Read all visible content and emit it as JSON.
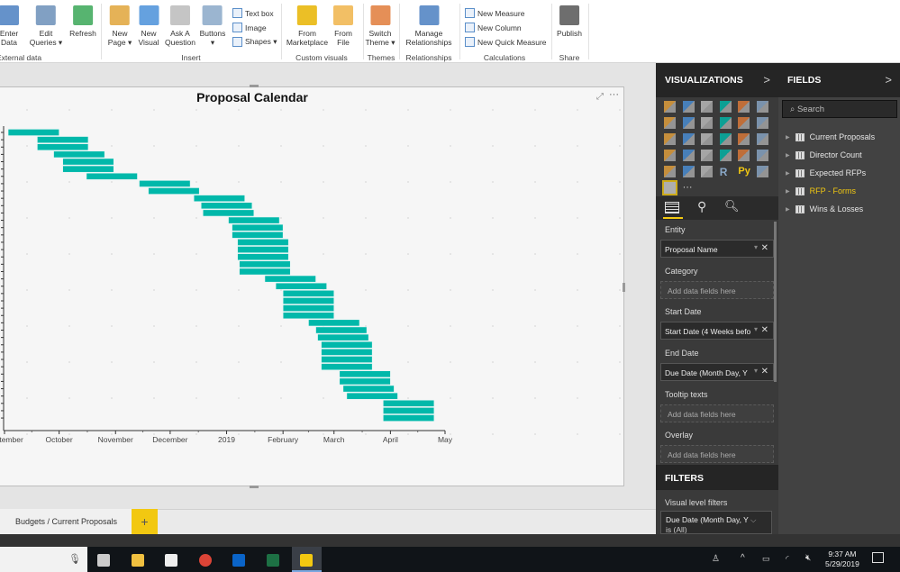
{
  "ribbon": {
    "buttons": [
      {
        "id": "enter-data",
        "label": "Enter\nData",
        "color": "#4a7fc1"
      },
      {
        "id": "edit-queries",
        "label": "Edit\nQueries ▾",
        "color": "#6b8fb8"
      },
      {
        "id": "refresh",
        "label": "Refresh",
        "color": "#3aa757"
      },
      {
        "id": "new-page",
        "label": "New\nPage ▾",
        "color": "#e0a43a"
      },
      {
        "id": "new-visual",
        "label": "New\nVisual",
        "color": "#4a90d9"
      },
      {
        "id": "ask-question",
        "label": "Ask A\nQuestion",
        "color": "#bbbbbb"
      },
      {
        "id": "buttons",
        "label": "Buttons\n▾",
        "color": "#8aa8c8"
      },
      {
        "id": "from-marketplace",
        "label": "From\nMarketplace",
        "color": "#e8b400"
      },
      {
        "id": "from-file",
        "label": "From\nFile",
        "color": "#f0b44a"
      },
      {
        "id": "switch-theme",
        "label": "Switch\nTheme ▾",
        "color": "#e07b39"
      },
      {
        "id": "manage-relationships",
        "label": "Manage\nRelationships",
        "color": "#4a7fc1"
      },
      {
        "id": "publish",
        "label": "Publish",
        "color": "#555555"
      }
    ],
    "small": [
      {
        "id": "text-box",
        "label": "Text box"
      },
      {
        "id": "image",
        "label": "Image"
      },
      {
        "id": "shapes",
        "label": "Shapes ▾"
      },
      {
        "id": "new-measure",
        "label": "New Measure"
      },
      {
        "id": "new-column",
        "label": "New Column"
      },
      {
        "id": "new-quick-measure",
        "label": "New Quick Measure"
      }
    ],
    "groups": [
      "External data",
      "Insert",
      "Custom visuals",
      "Themes",
      "Relationships",
      "Calculations",
      "Share"
    ]
  },
  "visual": {
    "title": "Proposal Calendar",
    "focus_icon": "focus-mode-icon",
    "more_icon": "more-options-icon"
  },
  "chart_data": {
    "type": "gantt",
    "title": "Proposal Calendar",
    "bar_color": "#01b8aa",
    "x_ticks": [
      "September",
      "October",
      "November",
      "December",
      "2019",
      "February",
      "March",
      "April",
      "May"
    ],
    "x_range": [
      "2018-09-01",
      "2019-05-01"
    ],
    "tasks": [
      {
        "start": "2018-09-03",
        "end": "2018-10-01"
      },
      {
        "start": "2018-09-19",
        "end": "2018-10-17"
      },
      {
        "start": "2018-09-19",
        "end": "2018-10-17"
      },
      {
        "start": "2018-09-28",
        "end": "2018-10-26"
      },
      {
        "start": "2018-10-03",
        "end": "2018-10-31"
      },
      {
        "start": "2018-10-03",
        "end": "2018-10-31"
      },
      {
        "start": "2018-10-16",
        "end": "2018-11-13"
      },
      {
        "start": "2018-11-14",
        "end": "2018-12-12"
      },
      {
        "start": "2018-11-19",
        "end": "2018-12-17"
      },
      {
        "start": "2018-12-14",
        "end": "2019-01-11"
      },
      {
        "start": "2018-12-18",
        "end": "2019-01-15"
      },
      {
        "start": "2018-12-19",
        "end": "2019-01-16"
      },
      {
        "start": "2019-01-02",
        "end": "2019-01-30"
      },
      {
        "start": "2019-01-04",
        "end": "2019-02-01"
      },
      {
        "start": "2019-01-04",
        "end": "2019-02-01"
      },
      {
        "start": "2019-01-07",
        "end": "2019-02-04"
      },
      {
        "start": "2019-01-07",
        "end": "2019-02-04"
      },
      {
        "start": "2019-01-07",
        "end": "2019-02-04"
      },
      {
        "start": "2019-01-08",
        "end": "2019-02-05"
      },
      {
        "start": "2019-01-08",
        "end": "2019-02-05"
      },
      {
        "start": "2019-01-22",
        "end": "2019-02-19"
      },
      {
        "start": "2019-01-28",
        "end": "2019-02-25"
      },
      {
        "start": "2019-02-01",
        "end": "2019-03-01"
      },
      {
        "start": "2019-02-01",
        "end": "2019-03-01"
      },
      {
        "start": "2019-02-01",
        "end": "2019-03-01"
      },
      {
        "start": "2019-02-01",
        "end": "2019-03-01"
      },
      {
        "start": "2019-02-15",
        "end": "2019-03-15"
      },
      {
        "start": "2019-02-19",
        "end": "2019-03-19"
      },
      {
        "start": "2019-02-20",
        "end": "2019-03-20"
      },
      {
        "start": "2019-02-22",
        "end": "2019-03-22"
      },
      {
        "start": "2019-02-22",
        "end": "2019-03-22"
      },
      {
        "start": "2019-02-22",
        "end": "2019-03-22"
      },
      {
        "start": "2019-02-22",
        "end": "2019-03-22"
      },
      {
        "start": "2019-03-04",
        "end": "2019-04-01"
      },
      {
        "start": "2019-03-04",
        "end": "2019-04-01"
      },
      {
        "start": "2019-03-06",
        "end": "2019-04-03"
      },
      {
        "start": "2019-03-08",
        "end": "2019-04-05"
      },
      {
        "start": "2019-03-28",
        "end": "2019-04-25"
      },
      {
        "start": "2019-03-28",
        "end": "2019-04-25"
      },
      {
        "start": "2019-03-28",
        "end": "2019-04-25"
      }
    ]
  },
  "pages": {
    "tab": "Budgets / Current Proposals",
    "add": "+"
  },
  "visualizations": {
    "title": "VISUALIZATIONS",
    "chevron": ">",
    "icons": [
      "stacked-bar",
      "stacked-column",
      "clustered-bar",
      "clustered-column",
      "100-stacked-bar",
      "100-stacked-column",
      "line-chart",
      "area-chart",
      "stacked-area",
      "line-stacked-column",
      "line-clustered-column",
      "ribbon-chart",
      "waterfall",
      "scatter",
      "pie",
      "donut",
      "treemap",
      "map",
      "filled-map",
      "funnel",
      "gauge",
      "card",
      "multi-row-card",
      "kpi",
      "slicer",
      "table",
      "matrix",
      "r-visual",
      "python-visual",
      "globe-map",
      "gantt",
      "more"
    ],
    "selected": "gantt",
    "r_label": "R",
    "py_label": "Py",
    "more_label": "···",
    "wells": [
      {
        "label": "Entity",
        "value": "Proposal Name",
        "filled": true
      },
      {
        "label": "Category",
        "value": "Add data fields here",
        "filled": false
      },
      {
        "label": "Start Date",
        "value": "Start Date (4 Weeks befo",
        "filled": true
      },
      {
        "label": "End Date",
        "value": "Due Date (Month Day, Y",
        "filled": true
      },
      {
        "label": "Tooltip texts",
        "value": "Add data fields here",
        "filled": false
      },
      {
        "label": "Overlay",
        "value": "Add data fields here",
        "filled": false
      }
    ],
    "filters": {
      "title": "FILTERS",
      "level": "Visual level filters",
      "filter": "Due Date (Month Day, Y",
      "filter_sub": "is (All)"
    }
  },
  "fields": {
    "title": "FIELDS",
    "chevron": ">",
    "search_placeholder": "Search",
    "tables": [
      {
        "name": "Current Proposals",
        "highlight": false
      },
      {
        "name": "Director Count",
        "highlight": false
      },
      {
        "name": "Expected RFPs",
        "highlight": false
      },
      {
        "name": "RFP - Forms",
        "highlight": true
      },
      {
        "name": "Wins & Losses",
        "highlight": false
      }
    ],
    "highlight_color": "#f2c811"
  },
  "taskbar": {
    "apps": [
      "task-view",
      "file-explorer",
      "store",
      "chrome",
      "outlook",
      "excel",
      "power-bi"
    ],
    "time": "9:37 AM",
    "date": "5/29/2019"
  }
}
